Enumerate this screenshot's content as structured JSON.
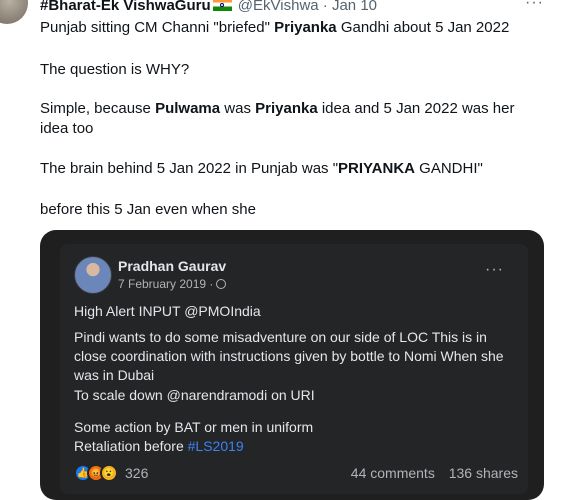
{
  "tweet": {
    "author_name": "#Bharat-Ek VishwaGuru",
    "handle": "@EkVishwa",
    "separator": "·",
    "time": "Jan 10",
    "more": "···",
    "line1": {
      "a": "Punjab sitting CM Channi \"briefed\" ",
      "b": "Priyanka",
      "c": " Gandhi about 5 Jan 2022"
    },
    "line2": "The question is WHY?",
    "line3": {
      "a": "Simple, because ",
      "b": "Pulwama",
      "c": " was ",
      "d": "Priyanka",
      "e": " idea and 5 Jan 2022 was her idea too"
    },
    "line4": {
      "a": "The brain behind 5 Jan 2022 in Punjab was \"",
      "b": "PRIYANKA",
      "c": " GANDHI\""
    },
    "line5": "before this 5 Jan even when she"
  },
  "embed": {
    "name": "Pradhan Gaurav",
    "date": "7 February 2019 ·",
    "more": "···",
    "text1": "High Alert INPUT @PMOIndia",
    "text2": "Pindi wants to do some misadventure on our side of LOC This is in close coordination with instructions given by bottle to Nomi When she was in Dubai",
    "text3": "To scale down @narendramodi on URI",
    "text4a": "Some action by BAT or men in uniform",
    "text4b": "Retaliation before ",
    "hashtag": "#LS2019",
    "reaction_count": "326",
    "comments": "44 comments",
    "shares": "136 shares",
    "reactions": [
      "like-icon",
      "angry-icon",
      "wow-icon"
    ]
  }
}
